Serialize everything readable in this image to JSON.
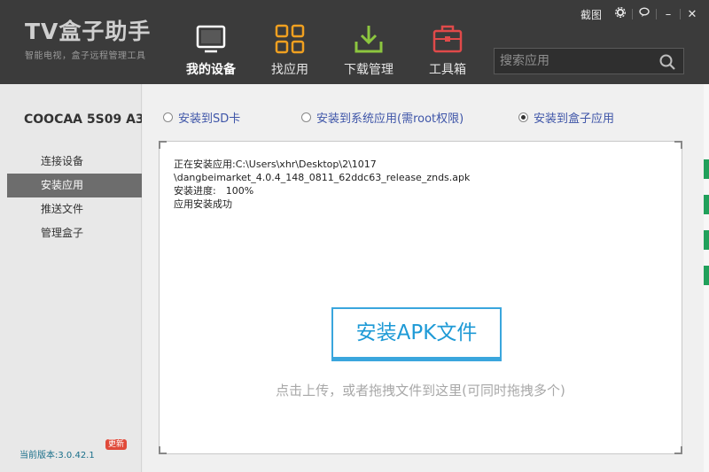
{
  "app": {
    "logo_title": "TV盒子助手",
    "logo_subtitle": "智能电视，盒子远程管理工具"
  },
  "window": {
    "screenshot": "截图",
    "settings_icon": "gear-icon",
    "feedback_icon": "chat-icon",
    "minimize": "–",
    "close": "✕"
  },
  "nav": [
    {
      "label": "我的设备",
      "icon": "tv-icon",
      "active": true
    },
    {
      "label": "找应用",
      "icon": "grid-icon",
      "active": false
    },
    {
      "label": "下载管理",
      "icon": "download-icon",
      "active": false
    },
    {
      "label": "工具箱",
      "icon": "toolbox-icon",
      "active": false
    }
  ],
  "search": {
    "placeholder": "搜索应用"
  },
  "sidebar": {
    "device_name": "COOCAA 5S09 A3",
    "items": [
      {
        "label": "连接设备",
        "active": false
      },
      {
        "label": "安装应用",
        "active": true
      },
      {
        "label": "推送文件",
        "active": false
      },
      {
        "label": "管理盒子",
        "active": false
      }
    ],
    "version": "当前版本:3.0.42.1",
    "new_badge": "更新"
  },
  "install_options": [
    {
      "label": "安装到SD卡",
      "checked": false
    },
    {
      "label": "安装到系统应用(需root权限)",
      "checked": false
    },
    {
      "label": "安装到盒子应用",
      "checked": true
    }
  ],
  "install_log": {
    "line1": "正在安装应用:C:\\Users\\xhr\\Desktop\\2\\1017",
    "line2": "\\dangbeimarket_4.0.4_148_0811_62ddc63_release_znds.apk",
    "line3": "安装进度:　100%",
    "line4": "应用安装成功"
  },
  "install_button": "安装APK文件",
  "drop_hint": "点击上传，或者拖拽文件到这里(可同时拖拽多个)",
  "colors": {
    "header_bg": "#3b3b3b",
    "accent": "#3aa6dd",
    "option_text": "#3e55a8",
    "sidebar_active": "#6d6d6d"
  }
}
